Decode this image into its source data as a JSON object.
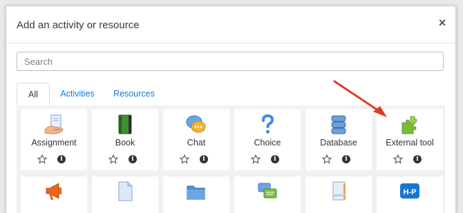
{
  "dialog": {
    "title": "Add an activity or resource",
    "close_symbol": "×"
  },
  "search": {
    "placeholder": "Search",
    "value": ""
  },
  "tabs": [
    {
      "label": "All",
      "active": true
    },
    {
      "label": "Activities",
      "active": false
    },
    {
      "label": "Resources",
      "active": false
    }
  ],
  "tiles": [
    {
      "label": "Assignment",
      "icon": "assignment-icon"
    },
    {
      "label": "Book",
      "icon": "book-icon"
    },
    {
      "label": "Chat",
      "icon": "chat-icon"
    },
    {
      "label": "Choice",
      "icon": "choice-icon"
    },
    {
      "label": "Database",
      "icon": "database-icon"
    },
    {
      "label": "External tool",
      "icon": "external-tool-icon"
    }
  ],
  "tiles_row2": [
    {
      "icon": "feedback-icon"
    },
    {
      "icon": "file-icon"
    },
    {
      "icon": "folder-icon"
    },
    {
      "icon": "forum-icon"
    },
    {
      "icon": "glossary-icon"
    },
    {
      "icon": "h5p-icon"
    }
  ],
  "tile_actions": {
    "star_icon": "star-outline-icon",
    "info_icon": "info-icon",
    "info_symbol": "i"
  },
  "h5p_text": "H-P",
  "colors": {
    "link": "#1177d1",
    "annotation_arrow": "#e03a24"
  }
}
